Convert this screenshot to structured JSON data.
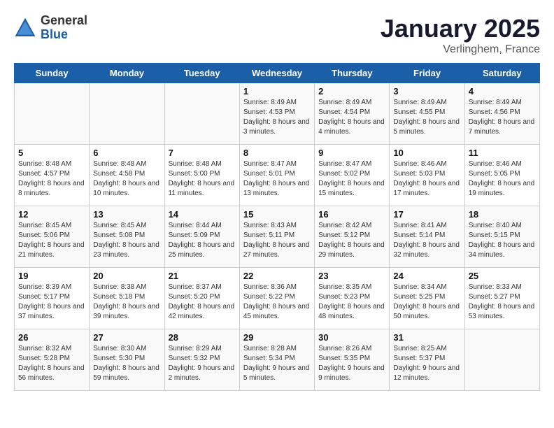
{
  "header": {
    "logo_general": "General",
    "logo_blue": "Blue",
    "calendar_title": "January 2025",
    "calendar_subtitle": "Verlinghem, France"
  },
  "days_of_week": [
    "Sunday",
    "Monday",
    "Tuesday",
    "Wednesday",
    "Thursday",
    "Friday",
    "Saturday"
  ],
  "weeks": [
    [
      {
        "day": "",
        "sunrise": "",
        "sunset": "",
        "daylight": ""
      },
      {
        "day": "",
        "sunrise": "",
        "sunset": "",
        "daylight": ""
      },
      {
        "day": "",
        "sunrise": "",
        "sunset": "",
        "daylight": ""
      },
      {
        "day": "1",
        "sunrise": "Sunrise: 8:49 AM",
        "sunset": "Sunset: 4:53 PM",
        "daylight": "Daylight: 8 hours and 3 minutes."
      },
      {
        "day": "2",
        "sunrise": "Sunrise: 8:49 AM",
        "sunset": "Sunset: 4:54 PM",
        "daylight": "Daylight: 8 hours and 4 minutes."
      },
      {
        "day": "3",
        "sunrise": "Sunrise: 8:49 AM",
        "sunset": "Sunset: 4:55 PM",
        "daylight": "Daylight: 8 hours and 5 minutes."
      },
      {
        "day": "4",
        "sunrise": "Sunrise: 8:49 AM",
        "sunset": "Sunset: 4:56 PM",
        "daylight": "Daylight: 8 hours and 7 minutes."
      }
    ],
    [
      {
        "day": "5",
        "sunrise": "Sunrise: 8:48 AM",
        "sunset": "Sunset: 4:57 PM",
        "daylight": "Daylight: 8 hours and 8 minutes."
      },
      {
        "day": "6",
        "sunrise": "Sunrise: 8:48 AM",
        "sunset": "Sunset: 4:58 PM",
        "daylight": "Daylight: 8 hours and 10 minutes."
      },
      {
        "day": "7",
        "sunrise": "Sunrise: 8:48 AM",
        "sunset": "Sunset: 5:00 PM",
        "daylight": "Daylight: 8 hours and 11 minutes."
      },
      {
        "day": "8",
        "sunrise": "Sunrise: 8:47 AM",
        "sunset": "Sunset: 5:01 PM",
        "daylight": "Daylight: 8 hours and 13 minutes."
      },
      {
        "day": "9",
        "sunrise": "Sunrise: 8:47 AM",
        "sunset": "Sunset: 5:02 PM",
        "daylight": "Daylight: 8 hours and 15 minutes."
      },
      {
        "day": "10",
        "sunrise": "Sunrise: 8:46 AM",
        "sunset": "Sunset: 5:03 PM",
        "daylight": "Daylight: 8 hours and 17 minutes."
      },
      {
        "day": "11",
        "sunrise": "Sunrise: 8:46 AM",
        "sunset": "Sunset: 5:05 PM",
        "daylight": "Daylight: 8 hours and 19 minutes."
      }
    ],
    [
      {
        "day": "12",
        "sunrise": "Sunrise: 8:45 AM",
        "sunset": "Sunset: 5:06 PM",
        "daylight": "Daylight: 8 hours and 21 minutes."
      },
      {
        "day": "13",
        "sunrise": "Sunrise: 8:45 AM",
        "sunset": "Sunset: 5:08 PM",
        "daylight": "Daylight: 8 hours and 23 minutes."
      },
      {
        "day": "14",
        "sunrise": "Sunrise: 8:44 AM",
        "sunset": "Sunset: 5:09 PM",
        "daylight": "Daylight: 8 hours and 25 minutes."
      },
      {
        "day": "15",
        "sunrise": "Sunrise: 8:43 AM",
        "sunset": "Sunset: 5:11 PM",
        "daylight": "Daylight: 8 hours and 27 minutes."
      },
      {
        "day": "16",
        "sunrise": "Sunrise: 8:42 AM",
        "sunset": "Sunset: 5:12 PM",
        "daylight": "Daylight: 8 hours and 29 minutes."
      },
      {
        "day": "17",
        "sunrise": "Sunrise: 8:41 AM",
        "sunset": "Sunset: 5:14 PM",
        "daylight": "Daylight: 8 hours and 32 minutes."
      },
      {
        "day": "18",
        "sunrise": "Sunrise: 8:40 AM",
        "sunset": "Sunset: 5:15 PM",
        "daylight": "Daylight: 8 hours and 34 minutes."
      }
    ],
    [
      {
        "day": "19",
        "sunrise": "Sunrise: 8:39 AM",
        "sunset": "Sunset: 5:17 PM",
        "daylight": "Daylight: 8 hours and 37 minutes."
      },
      {
        "day": "20",
        "sunrise": "Sunrise: 8:38 AM",
        "sunset": "Sunset: 5:18 PM",
        "daylight": "Daylight: 8 hours and 39 minutes."
      },
      {
        "day": "21",
        "sunrise": "Sunrise: 8:37 AM",
        "sunset": "Sunset: 5:20 PM",
        "daylight": "Daylight: 8 hours and 42 minutes."
      },
      {
        "day": "22",
        "sunrise": "Sunrise: 8:36 AM",
        "sunset": "Sunset: 5:22 PM",
        "daylight": "Daylight: 8 hours and 45 minutes."
      },
      {
        "day": "23",
        "sunrise": "Sunrise: 8:35 AM",
        "sunset": "Sunset: 5:23 PM",
        "daylight": "Daylight: 8 hours and 48 minutes."
      },
      {
        "day": "24",
        "sunrise": "Sunrise: 8:34 AM",
        "sunset": "Sunset: 5:25 PM",
        "daylight": "Daylight: 8 hours and 50 minutes."
      },
      {
        "day": "25",
        "sunrise": "Sunrise: 8:33 AM",
        "sunset": "Sunset: 5:27 PM",
        "daylight": "Daylight: 8 hours and 53 minutes."
      }
    ],
    [
      {
        "day": "26",
        "sunrise": "Sunrise: 8:32 AM",
        "sunset": "Sunset: 5:28 PM",
        "daylight": "Daylight: 8 hours and 56 minutes."
      },
      {
        "day": "27",
        "sunrise": "Sunrise: 8:30 AM",
        "sunset": "Sunset: 5:30 PM",
        "daylight": "Daylight: 8 hours and 59 minutes."
      },
      {
        "day": "28",
        "sunrise": "Sunrise: 8:29 AM",
        "sunset": "Sunset: 5:32 PM",
        "daylight": "Daylight: 9 hours and 2 minutes."
      },
      {
        "day": "29",
        "sunrise": "Sunrise: 8:28 AM",
        "sunset": "Sunset: 5:34 PM",
        "daylight": "Daylight: 9 hours and 5 minutes."
      },
      {
        "day": "30",
        "sunrise": "Sunrise: 8:26 AM",
        "sunset": "Sunset: 5:35 PM",
        "daylight": "Daylight: 9 hours and 9 minutes."
      },
      {
        "day": "31",
        "sunrise": "Sunrise: 8:25 AM",
        "sunset": "Sunset: 5:37 PM",
        "daylight": "Daylight: 9 hours and 12 minutes."
      },
      {
        "day": "",
        "sunrise": "",
        "sunset": "",
        "daylight": ""
      }
    ]
  ]
}
